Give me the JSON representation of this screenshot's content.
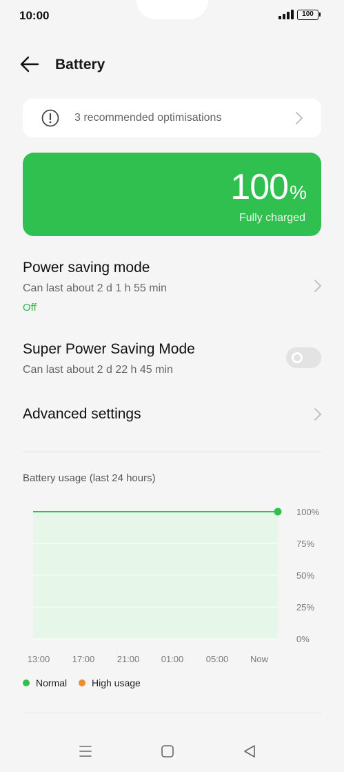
{
  "status": {
    "time": "10:00",
    "battery_level": "100"
  },
  "header": {
    "title": "Battery"
  },
  "recommendations": {
    "text": "3 recommended optimisations"
  },
  "battery": {
    "percent": "100",
    "percent_sign": "%",
    "status": "Fully charged",
    "color": "#30c04f"
  },
  "power_saving": {
    "title": "Power saving mode",
    "subtitle": "Can last about 2 d 1 h 55 min",
    "status": "Off"
  },
  "super_power_saving": {
    "title": "Super Power Saving Mode",
    "subtitle": "Can last about 2 d 22 h 45 min",
    "enabled": false
  },
  "advanced": {
    "title": "Advanced settings"
  },
  "usage": {
    "title": "Battery usage (last 24 hours)"
  },
  "chart_data": {
    "type": "area",
    "x": [
      "13:00",
      "17:00",
      "21:00",
      "01:00",
      "05:00",
      "Now"
    ],
    "series": [
      {
        "values": [
          100,
          100,
          100,
          100,
          100,
          100
        ],
        "color": "#30c04f"
      }
    ],
    "y_ticks": [
      "100%",
      "75%",
      "50%",
      "25%",
      "0%"
    ],
    "ylim": [
      0,
      100
    ],
    "grid": true,
    "legend": [
      {
        "label": "Normal",
        "color": "#30c04f"
      },
      {
        "label": "High usage",
        "color": "#f5892f"
      }
    ]
  },
  "icons": {
    "back": "arrow-left-icon",
    "alert": "exclamation-circle-icon",
    "chevron": "chevron-right-icon",
    "nav_menu": "menu-icon",
    "nav_home": "square-home-icon",
    "nav_back": "triangle-back-icon"
  }
}
